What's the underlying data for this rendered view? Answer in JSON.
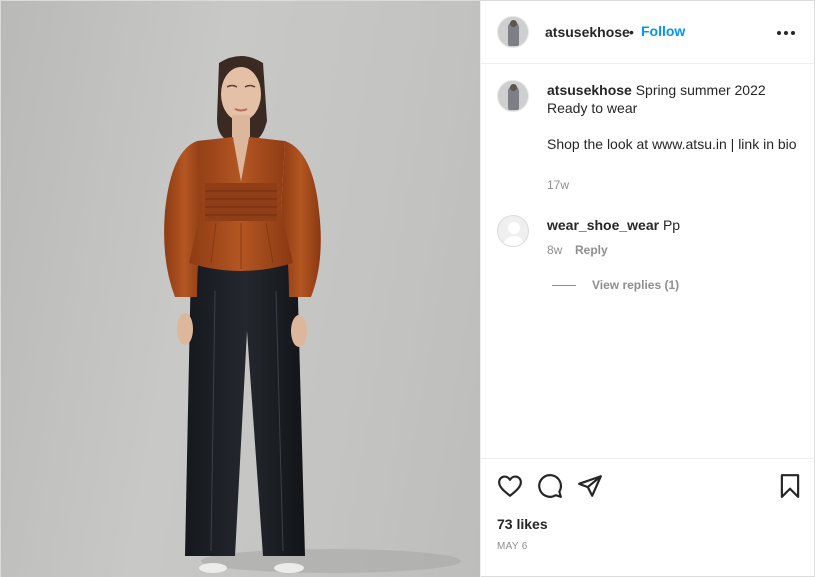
{
  "post": {
    "username": "atsusekhose",
    "dot": "•",
    "follow_label": "Follow",
    "more_icon": "more-options-icon"
  },
  "caption": {
    "username": "atsusekhose",
    "text_line1": "Spring summer 2022",
    "text_line2": "Ready to wear",
    "shop_text": "Shop the look at www.atsu.in | link in bio",
    "time": "17w"
  },
  "comments": [
    {
      "username": "wear_shoe_wear",
      "text": "Pp",
      "time": "8w",
      "reply_label": "Reply",
      "view_replies": "View replies (1)"
    }
  ],
  "actions": {
    "icons": [
      "heart-icon",
      "comment-icon",
      "share-icon",
      "bookmark-icon"
    ],
    "likes": "73 likes",
    "date": "MAY 6"
  },
  "colors": {
    "accent": "#0095f6",
    "text": "#262626",
    "muted": "#8e8e8e",
    "border": "#efefef"
  }
}
